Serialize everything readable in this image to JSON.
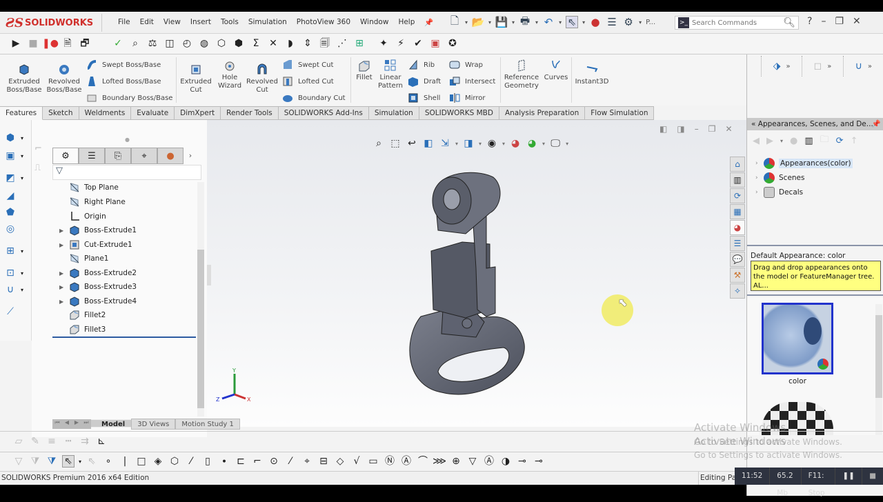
{
  "app": {
    "brand": "SOLIDWORKS",
    "brand_ds": "3S"
  },
  "menu": [
    "File",
    "Edit",
    "View",
    "Insert",
    "Tools",
    "Simulation",
    "PhotoView 360",
    "Window",
    "Help"
  ],
  "search": {
    "placeholder": "Search Commands"
  },
  "quick_access_more": "P...",
  "command_manager": {
    "large_buttons": [
      {
        "label": "Extruded Boss/Base",
        "icon": "extruded-boss-icon"
      },
      {
        "label": "Revolved Boss/Base",
        "icon": "revolved-boss-icon"
      },
      {
        "label": "Extruded Cut",
        "icon": "extruded-cut-icon"
      },
      {
        "label": "Hole Wizard",
        "icon": "hole-wizard-icon"
      },
      {
        "label": "Revolved Cut",
        "icon": "revolved-cut-icon"
      },
      {
        "label": "Fillet",
        "icon": "fillet-icon"
      },
      {
        "label": "Linear Pattern",
        "icon": "linear-pattern-icon"
      },
      {
        "label": "Reference Geometry",
        "icon": "reference-geometry-icon"
      },
      {
        "label": "Curves",
        "icon": "curves-icon"
      },
      {
        "label": "Instant3D",
        "icon": "instant3d-icon"
      }
    ],
    "small_buttons": [
      {
        "label": "Swept Boss/Base"
      },
      {
        "label": "Lofted Boss/Base"
      },
      {
        "label": "Boundary Boss/Base"
      },
      {
        "label": "Swept Cut"
      },
      {
        "label": "Lofted Cut"
      },
      {
        "label": "Boundary Cut"
      },
      {
        "label": "Rib"
      },
      {
        "label": "Draft"
      },
      {
        "label": "Shell"
      },
      {
        "label": "Wrap"
      },
      {
        "label": "Intersect"
      },
      {
        "label": "Mirror"
      }
    ]
  },
  "tabs": [
    {
      "label": "Features",
      "active": true
    },
    {
      "label": "Sketch"
    },
    {
      "label": "Weldments"
    },
    {
      "label": "Evaluate"
    },
    {
      "label": "DimXpert"
    },
    {
      "label": "Render Tools"
    },
    {
      "label": "SOLIDWORKS Add-Ins"
    },
    {
      "label": "Simulation"
    },
    {
      "label": "SOLIDWORKS MBD"
    },
    {
      "label": "Analysis Preparation"
    },
    {
      "label": "Flow Simulation"
    }
  ],
  "feature_tree": {
    "items": [
      {
        "label": "Top Plane",
        "icon": "plane-icon",
        "expandable": false
      },
      {
        "label": "Right Plane",
        "icon": "plane-icon",
        "expandable": false
      },
      {
        "label": "Origin",
        "icon": "origin-icon",
        "expandable": false
      },
      {
        "label": "Boss-Extrude1",
        "icon": "boss-extrude-icon",
        "expandable": true
      },
      {
        "label": "Cut-Extrude1",
        "icon": "cut-extrude-icon",
        "expandable": true
      },
      {
        "label": "Plane1",
        "icon": "plane-icon",
        "expandable": false
      },
      {
        "label": "Boss-Extrude2",
        "icon": "boss-extrude-icon",
        "expandable": true
      },
      {
        "label": "Boss-Extrude3",
        "icon": "boss-extrude-icon",
        "expandable": true
      },
      {
        "label": "Boss-Extrude4",
        "icon": "boss-extrude-icon",
        "expandable": true
      },
      {
        "label": "Fillet2",
        "icon": "fillet-icon",
        "expandable": false
      },
      {
        "label": "Fillet3",
        "icon": "fillet-icon",
        "expandable": false
      }
    ]
  },
  "triad": {
    "x": "X",
    "y": "Y",
    "z": "Z"
  },
  "right_panel": {
    "title": "Appearances, Scenes, and De...",
    "tree": [
      {
        "label": "Appearances(color)",
        "selected": true
      },
      {
        "label": "Scenes"
      },
      {
        "label": "Decals"
      }
    ],
    "default_appearance": "Default Appearance: color",
    "tooltip": "Drag and drop appearances onto the model or FeatureManager tree.  AL...",
    "thumbnails": [
      {
        "label": "color"
      },
      {
        "label": ""
      }
    ]
  },
  "model_tabs": [
    {
      "label": "Model",
      "active": true
    },
    {
      "label": "3D Views"
    },
    {
      "label": "Motion Study 1"
    }
  ],
  "status": {
    "edition": "SOLIDWORKS Premium 2016 x64 Edition",
    "editing": "Editing Pa"
  },
  "recorder": {
    "time": "11:52",
    "size": "65.2 Mb",
    "stop": "F11: Stop"
  },
  "watermark": {
    "title": "Activate Windows",
    "sub": "Go to Settings to activate Windows."
  }
}
